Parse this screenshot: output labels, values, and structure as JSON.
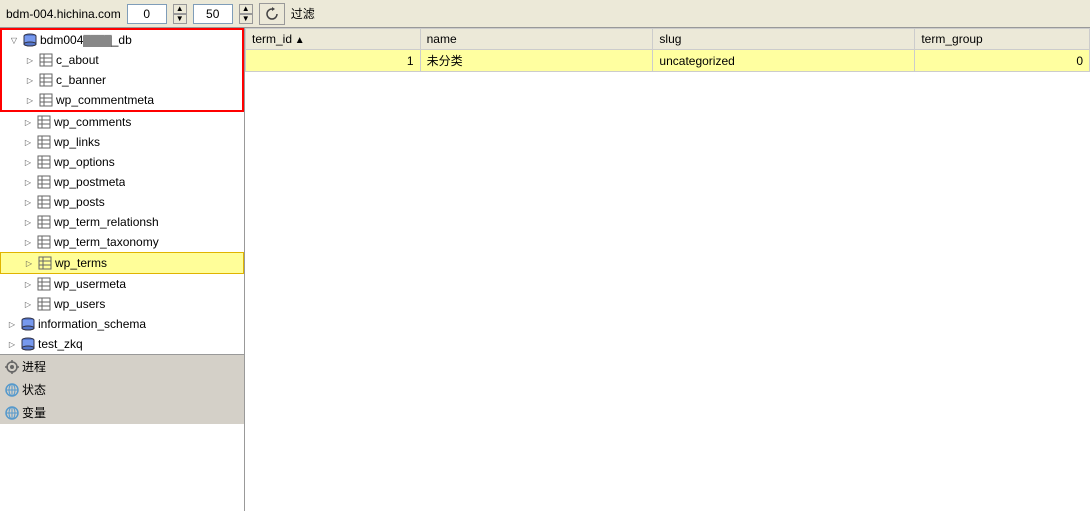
{
  "toolbar": {
    "server": "bdm-004.hichina.com",
    "value1": "0",
    "value2": "50",
    "filter_label": "过滤",
    "spin_up": "▲",
    "spin_down": "▼"
  },
  "sidebar": {
    "databases": [
      {
        "name": "bdm004_db",
        "display": "bdm004████_db",
        "expanded": true,
        "highlighted": true,
        "tables": [
          {
            "name": "c_about",
            "highlighted": true
          },
          {
            "name": "c_banner",
            "highlighted": true
          },
          {
            "name": "wp_commentmeta",
            "highlighted": true
          },
          {
            "name": "wp_comments"
          },
          {
            "name": "wp_links"
          },
          {
            "name": "wp_options"
          },
          {
            "name": "wp_postmeta"
          },
          {
            "name": "wp_posts"
          },
          {
            "name": "wp_term_relationsh"
          },
          {
            "name": "wp_term_taxonomy"
          },
          {
            "name": "wp_terms",
            "selected": true
          },
          {
            "name": "wp_usermeta"
          },
          {
            "name": "wp_users"
          }
        ]
      },
      {
        "name": "information_schema"
      },
      {
        "name": "test_zkq"
      }
    ],
    "special_items": [
      {
        "icon": "process",
        "label": "进程"
      },
      {
        "icon": "status",
        "label": "状态"
      },
      {
        "icon": "variable",
        "label": "变量"
      }
    ]
  },
  "table": {
    "columns": [
      {
        "id": "term_id",
        "label": "term_id",
        "sorted": true
      },
      {
        "id": "name",
        "label": "name"
      },
      {
        "id": "slug",
        "label": "slug"
      },
      {
        "id": "term_group",
        "label": "term_group"
      }
    ],
    "rows": [
      {
        "term_id": "1",
        "name": "未分类",
        "slug": "uncategorized",
        "term_group": "0"
      }
    ]
  }
}
